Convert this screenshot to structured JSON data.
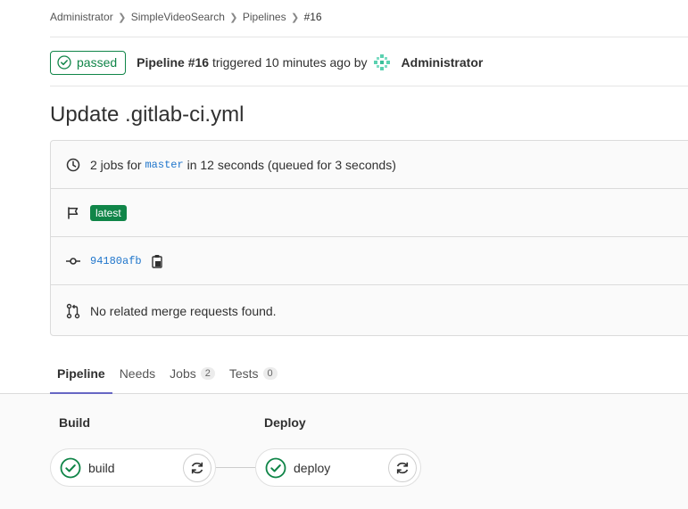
{
  "breadcrumb": [
    "Administrator",
    "SimpleVideoSearch",
    "Pipelines",
    "#16"
  ],
  "header": {
    "status": "passed",
    "pipeline_label": "Pipeline #16",
    "triggered_text": "triggered 10 minutes ago by",
    "user": "Administrator"
  },
  "title": "Update .gitlab-ci.yml",
  "info": {
    "jobs_prefix": "2 jobs for",
    "branch": "master",
    "jobs_suffix": "in 12 seconds (queued for 3 seconds)",
    "latest_badge": "latest",
    "commit_sha": "94180afb",
    "merge_requests": "No related merge requests found."
  },
  "tabs": [
    {
      "label": "Pipeline"
    },
    {
      "label": "Needs"
    },
    {
      "label": "Jobs",
      "count": "2"
    },
    {
      "label": "Tests",
      "count": "0"
    }
  ],
  "stages": [
    {
      "name": "Build",
      "job": "build"
    },
    {
      "name": "Deploy",
      "job": "deploy"
    }
  ],
  "colors": {
    "success": "#108548",
    "link": "#1f75cb",
    "tab_active": "#6666c4"
  },
  "icons": {
    "status": "status-success-icon",
    "clock": "clock-icon",
    "flag": "flag-icon",
    "commit": "commit-icon",
    "copy": "copy-icon",
    "merge_request": "merge-request-icon",
    "retry": "retry-icon"
  }
}
